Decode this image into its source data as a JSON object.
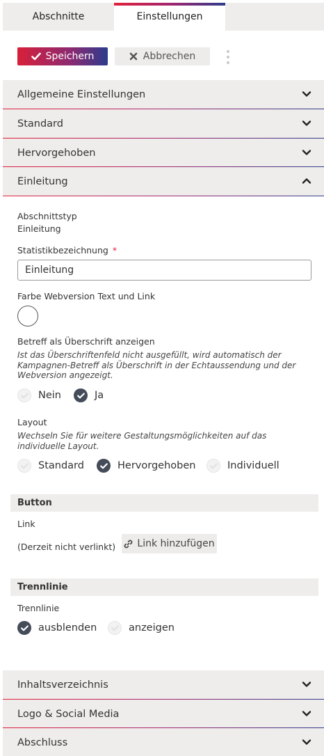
{
  "tabs": [
    {
      "label": "Abschnitte"
    },
    {
      "label": "Einstellungen"
    }
  ],
  "toolbar": {
    "save_label": "Speichern",
    "cancel_label": "Abbrechen"
  },
  "accordion_top": [
    {
      "label": "Allgemeine Einstellungen",
      "expanded": false
    },
    {
      "label": "Standard",
      "expanded": false
    },
    {
      "label": "Hervorgehoben",
      "expanded": false
    },
    {
      "label": "Einleitung",
      "expanded": true
    }
  ],
  "einleitung": {
    "section_type_label": "Abschnittstyp",
    "section_type_value": "Einleitung",
    "stat_label": "Statistikbezeichnung",
    "required_mark": "*",
    "stat_value": "Einleitung",
    "color_label": "Farbe Webversion Text und Link",
    "subject_label": "Betreff als Überschrift anzeigen",
    "subject_help": "Ist das Überschriftenfeld nicht ausgefüllt, wird automatisch der Kampagnen-Betreff als Überschrift in der Echtaussendung und der Webversion angezeigt.",
    "subject_options": [
      {
        "label": "Nein",
        "checked": false
      },
      {
        "label": "Ja",
        "checked": true
      }
    ],
    "layout_label": "Layout",
    "layout_help": "Wechseln Sie für weitere Gestaltungsmöglichkeiten auf das individuelle Layout.",
    "layout_options": [
      {
        "label": "Standard",
        "checked": false
      },
      {
        "label": "Hervorgehoben",
        "checked": true
      },
      {
        "label": "Individuell",
        "checked": false
      }
    ],
    "button_section_title": "Button",
    "link_label": "Link",
    "link_status": "(Derzeit nicht verlinkt)",
    "add_link_label": "Link hinzufügen",
    "divider_section_title": "Trennlinie",
    "divider_label": "Trennlinie",
    "divider_options": [
      {
        "label": "ausblenden",
        "checked": true
      },
      {
        "label": "anzeigen",
        "checked": false
      }
    ]
  },
  "accordion_bottom": [
    {
      "label": "Inhaltsverzeichnis",
      "expanded": false
    },
    {
      "label": "Logo & Social Media",
      "expanded": false
    },
    {
      "label": "Abschluss",
      "expanded": false
    }
  ],
  "colors": {
    "accent_red": "#e0203a",
    "accent_blue": "#2c3c8c",
    "check_on": "#444b59",
    "header_bg": "#efedeb"
  }
}
